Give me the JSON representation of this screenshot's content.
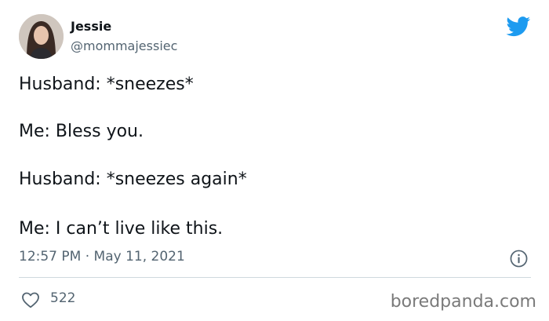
{
  "author": {
    "name": "Jessie",
    "handle": "@mommajessiec"
  },
  "tweet": {
    "lines": [
      "Husband: *sneezes*",
      "Me: Bless you.",
      "Husband: *sneezes again*",
      "Me: I can’t live like this."
    ],
    "timestamp": "12:57 PM · May 11, 2021",
    "likes": "522"
  },
  "watermark": "boredpanda.com",
  "icons": {
    "brand": "twitter-bird-icon",
    "info": "info-icon",
    "like": "heart-icon"
  },
  "colors": {
    "twitter_blue": "#1d9bf0",
    "text": "#0f1419",
    "secondary_text": "#536471",
    "divider": "#cfd9de"
  }
}
